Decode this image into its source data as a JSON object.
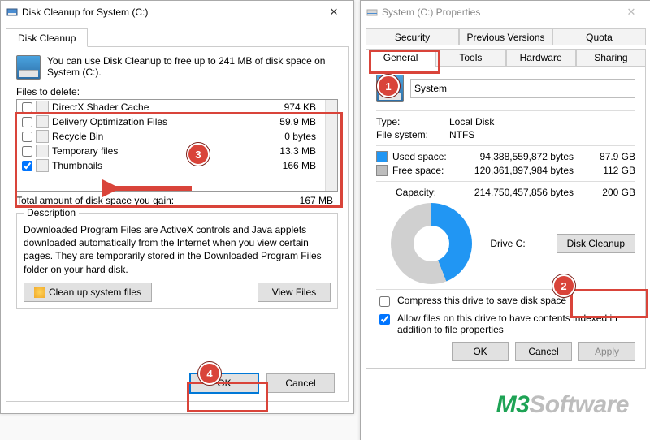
{
  "cleanup": {
    "title": "Disk Cleanup for System (C:)",
    "tab_label": "Disk Cleanup",
    "intro": "You can use Disk Cleanup to free up to 241 MB of disk space on System (C:).",
    "files_to_delete_label": "Files to delete:",
    "items": [
      {
        "name": "DirectX Shader Cache",
        "size": "974 KB",
        "checked": false
      },
      {
        "name": "Delivery Optimization Files",
        "size": "59.9 MB",
        "checked": false
      },
      {
        "name": "Recycle Bin",
        "size": "0 bytes",
        "checked": false
      },
      {
        "name": "Temporary files",
        "size": "13.3 MB",
        "checked": false
      },
      {
        "name": "Thumbnails",
        "size": "166 MB",
        "checked": true
      }
    ],
    "total_label": "Total amount of disk space you gain:",
    "total_value": "167 MB",
    "description_legend": "Description",
    "description_text": "Downloaded Program Files are ActiveX controls and Java applets downloaded automatically from the Internet when you view certain pages. They are temporarily stored in the Downloaded Program Files folder on your hard disk.",
    "clean_system_btn": "Clean up system files",
    "view_files_btn": "View Files",
    "ok_btn": "OK",
    "cancel_btn": "Cancel"
  },
  "properties": {
    "title": "System (C:) Properties",
    "tabs_row1": [
      "Security",
      "Previous Versions",
      "Quota"
    ],
    "tabs_row2": [
      "General",
      "Tools",
      "Hardware",
      "Sharing"
    ],
    "active_tab": "General",
    "name_value": "System",
    "type_label": "Type:",
    "type_value": "Local Disk",
    "fs_label": "File system:",
    "fs_value": "NTFS",
    "used_label": "Used space:",
    "used_bytes": "94,388,559,872 bytes",
    "used_gb": "87.9 GB",
    "free_label": "Free space:",
    "free_bytes": "120,361,897,984 bytes",
    "free_gb": "112 GB",
    "capacity_label": "Capacity:",
    "capacity_bytes": "214,750,457,856 bytes",
    "capacity_gb": "200 GB",
    "drive_label": "Drive C:",
    "disk_cleanup_btn": "Disk Cleanup",
    "compress_label": "Compress this drive to save disk space",
    "index_label": "Allow files on this drive to have contents indexed in addition to file properties",
    "ok_btn": "OK",
    "cancel_btn": "Cancel",
    "apply_btn": "Apply"
  },
  "annotations": {
    "callouts": [
      "1",
      "2",
      "3",
      "4"
    ]
  },
  "watermark": {
    "m3": "M3",
    "soft": "Software"
  }
}
